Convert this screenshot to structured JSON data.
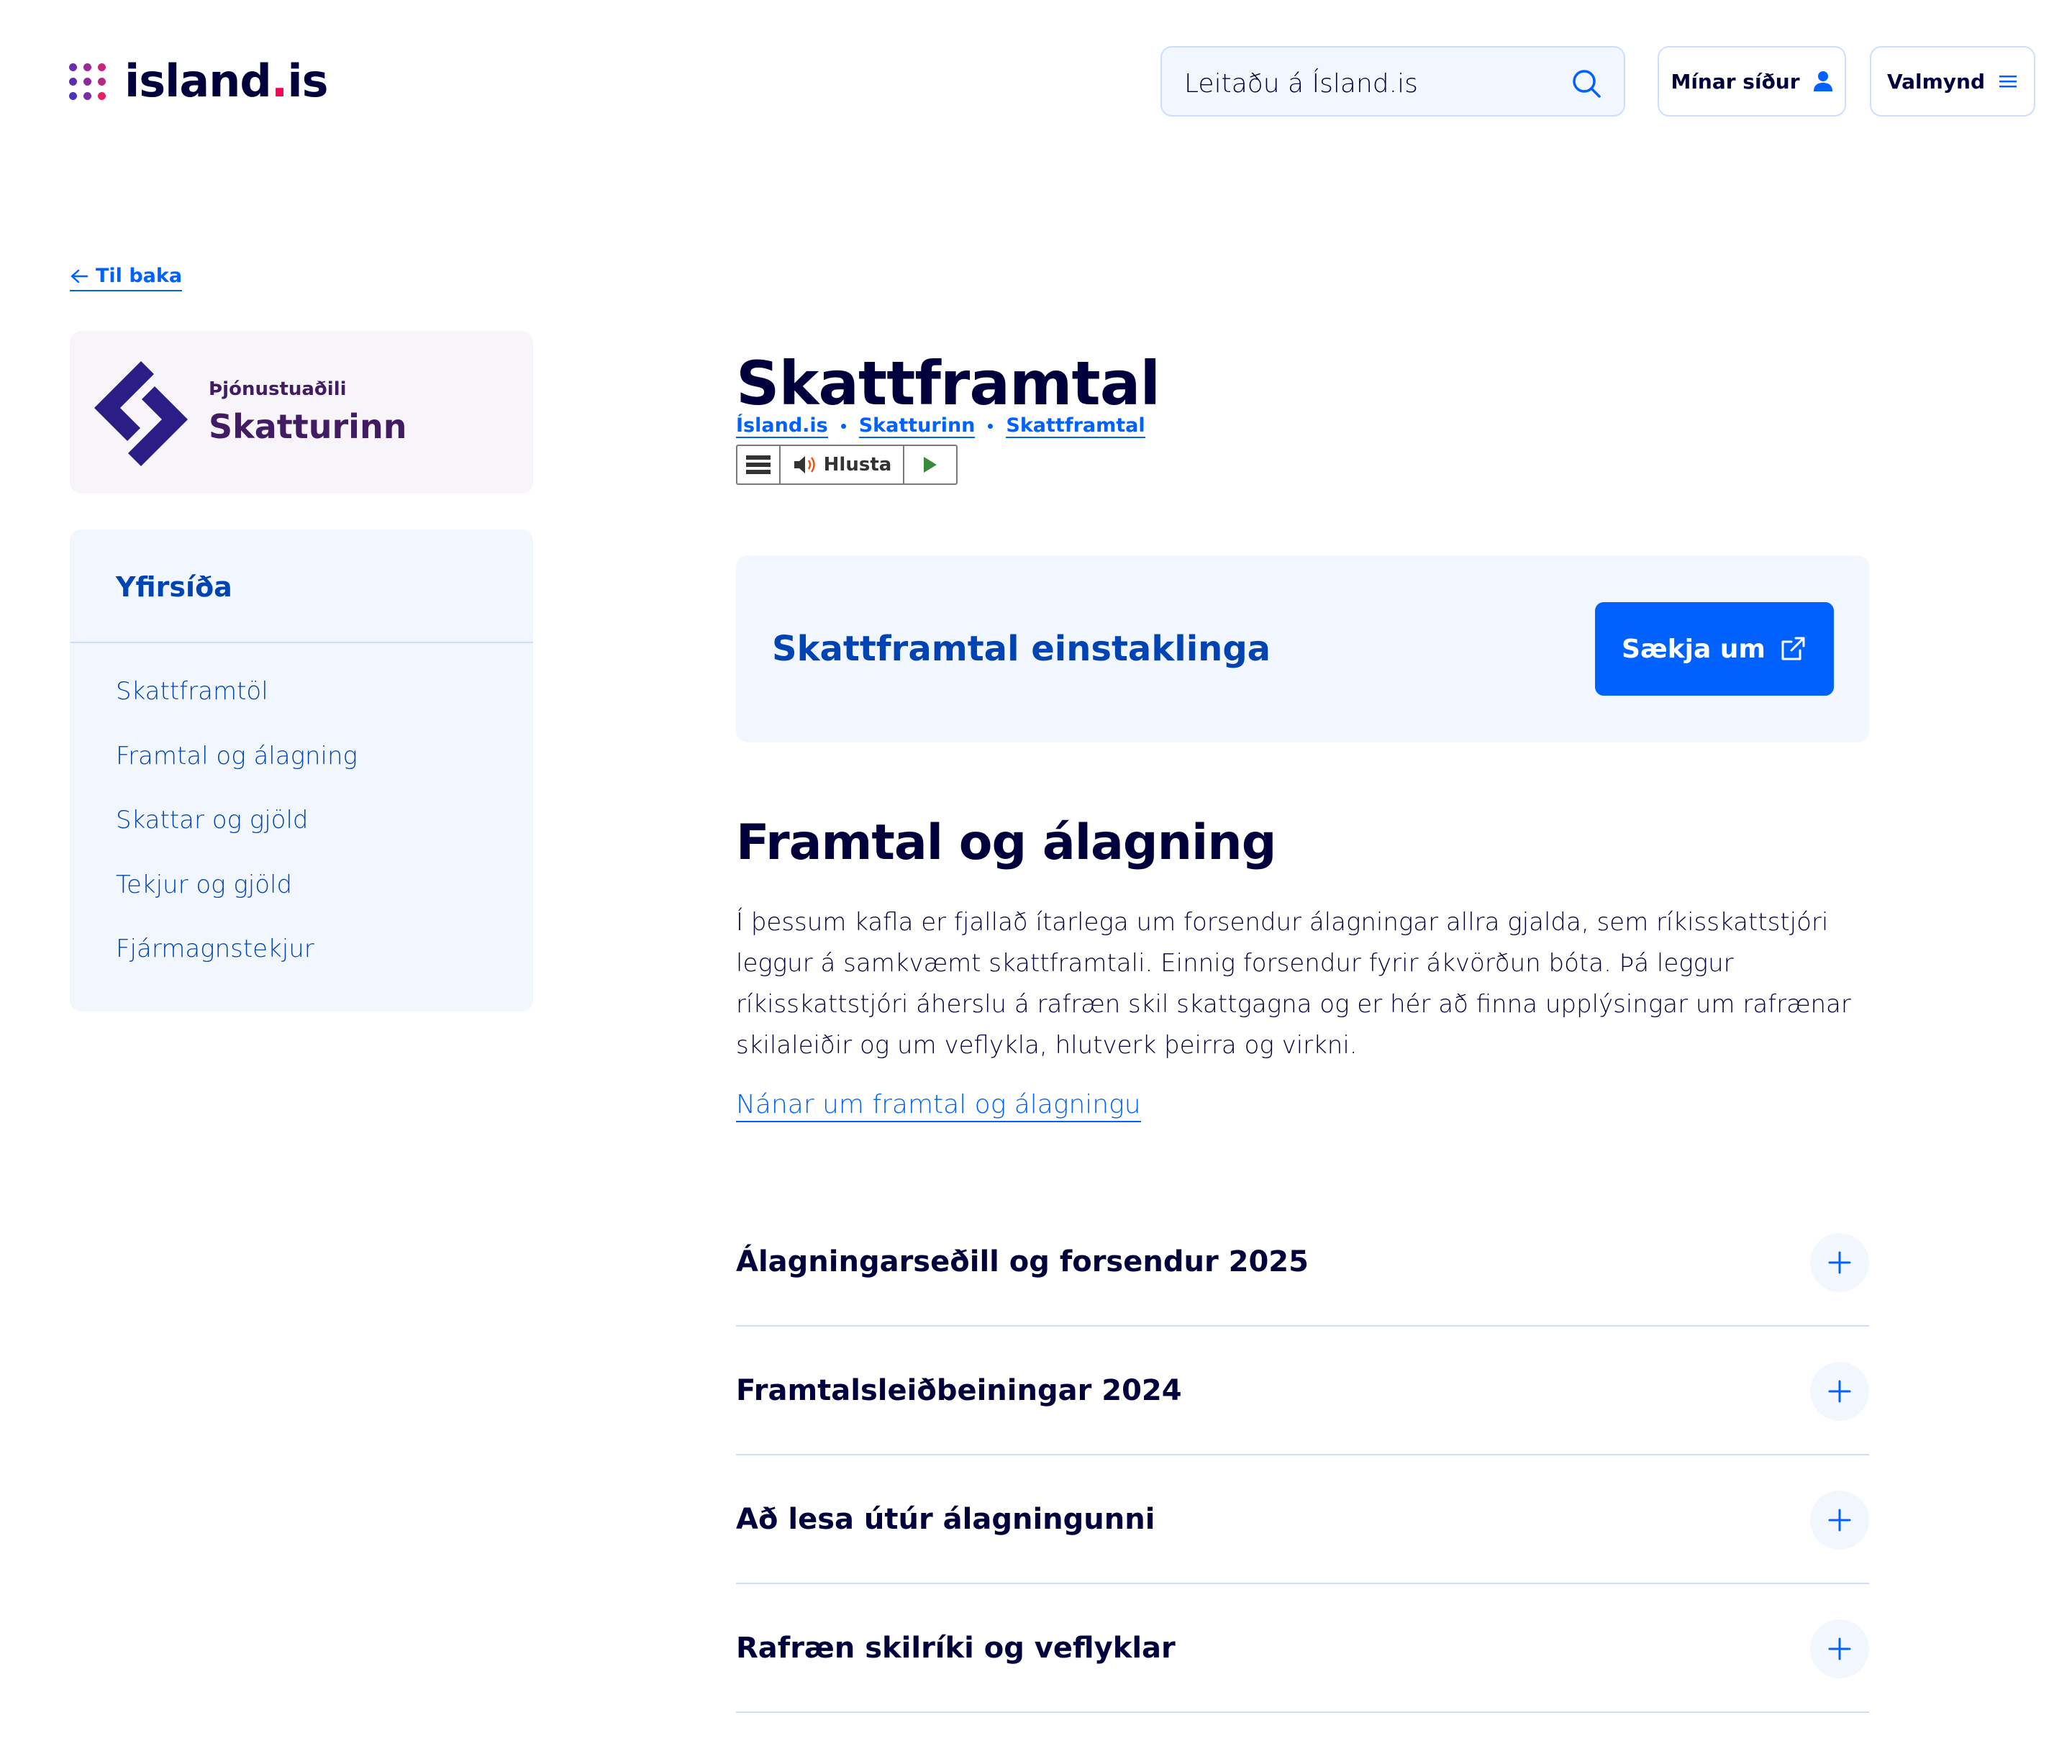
{
  "brand": {
    "name_main": "island",
    "name_dot": ".",
    "name_tld": "is",
    "dot_colors": [
      "#6a2eae",
      "#9a2a97",
      "#c42680",
      "#5b2eb0",
      "#8a2c9d",
      "#b62886",
      "#4a35b6",
      "#7a2fa4",
      "#e5225f"
    ]
  },
  "header": {
    "search_placeholder": "Leitaðu á Ísland.is",
    "my_pages_label": "Mínar síður",
    "menu_label": "Valmynd"
  },
  "back_link": {
    "label": "Til baka"
  },
  "provider": {
    "kicker": "Þjónustuaðili",
    "name": "Skatturinn",
    "color": "#2a1d85"
  },
  "sidenav": {
    "title": "Yfirsíða",
    "items": [
      {
        "label": "Skattframtöl"
      },
      {
        "label": "Framtal og álagning"
      },
      {
        "label": "Skattar og gjöld"
      },
      {
        "label": "Tekjur og gjöld"
      },
      {
        "label": "Fjármagnstekjur"
      }
    ]
  },
  "page": {
    "title": "Skattframtal",
    "breadcrumb": [
      "Ísland.is",
      "Skatturinn",
      "Skattframtal"
    ],
    "listen_label": "Hlusta"
  },
  "cta": {
    "title": "Skattframtal einstaklinga",
    "button_label": "Sækja um"
  },
  "section": {
    "title": "Framtal og álagning",
    "body": "Í þessum kafla er fjallað ítarlega um forsendur álagningar allra gjalda, sem ríkisskattstjóri leggur á samkvæmt skattframtali. Einnig forsendur fyrir ákvörðun bóta. Þá leggur ríkisskattstjóri áherslu á rafræn skil skattgagna og er hér að finna upplýsingar um rafrænar skilaleiðir og um veflykla, hlutverk þeirra og virkni.",
    "link_label": "Nánar um framtal og álagningu"
  },
  "accordion": [
    {
      "title": "Álagningarseðill og forsendur 2025"
    },
    {
      "title": "Framtalsleiðbeiningar 2024"
    },
    {
      "title": "Að lesa útúr álagningunni"
    },
    {
      "title": "Rafræn skilríki og veflyklar"
    }
  ],
  "colors": {
    "primary": "#0061ff",
    "primary_dark": "#0044b3",
    "text": "#00003c",
    "blue_tint": "#f2f7ff",
    "border": "#ccdfff"
  }
}
